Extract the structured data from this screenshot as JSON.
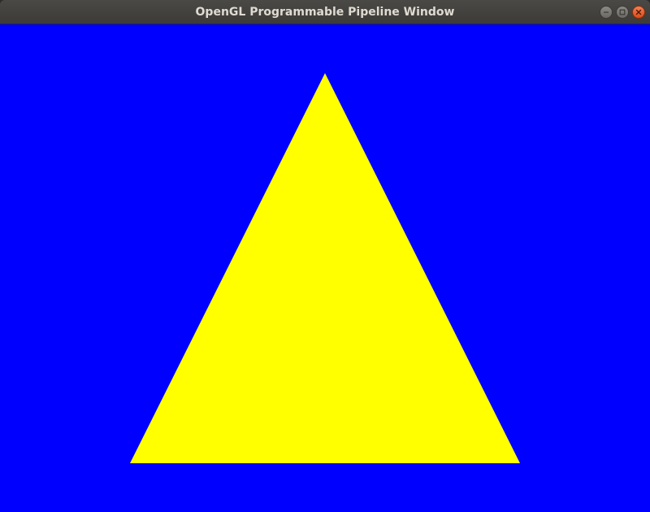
{
  "window": {
    "title": "OpenGL Programmable Pipeline Window",
    "controls": [
      "minimize",
      "maximize",
      "close"
    ]
  },
  "scene": {
    "clear_color": "#0000ff",
    "shape": "triangle",
    "shape_color": "#ffff00",
    "vertices_ndc": [
      {
        "x": 0.0,
        "y": 0.8
      },
      {
        "x": -0.6,
        "y": -0.8
      },
      {
        "x": 0.6,
        "y": -0.8
      }
    ]
  }
}
